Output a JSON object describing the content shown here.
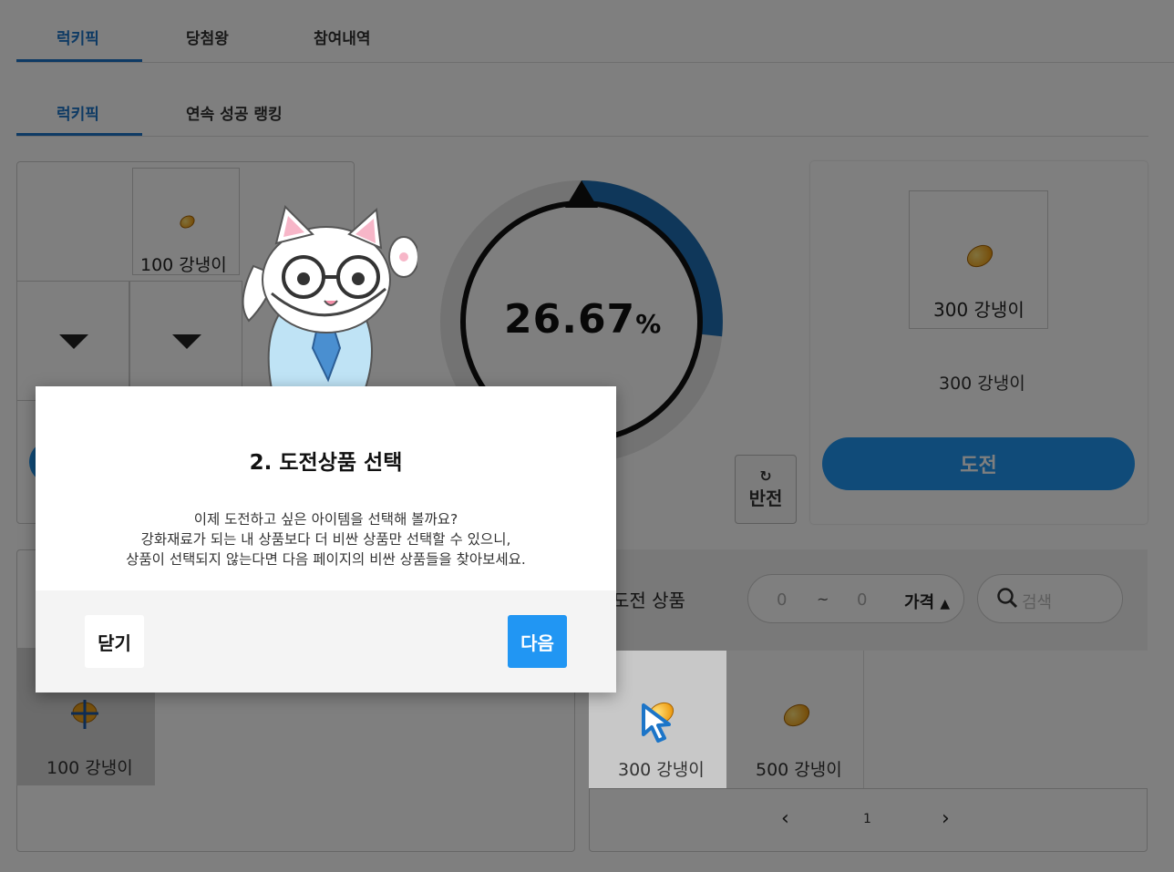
{
  "tabs_main": [
    "럭키픽",
    "당첨왕",
    "참여내역"
  ],
  "tabs_sub": [
    "럭키픽",
    "연속 성공 랭킹"
  ],
  "my_items": {
    "top_item_label": "100 강냉이",
    "bottom_item_label": "100 강냉이"
  },
  "gauge": {
    "percent_value": "26.67",
    "percent_unit": "%",
    "fill_fraction": 0.2667
  },
  "flip_button": {
    "label": "반전"
  },
  "selected_prize": {
    "card_label": "300 강냉이",
    "caption": "300 강냉이",
    "challenge_button": "도전"
  },
  "challenge_list": {
    "title": "도전 상품",
    "price_min": "0",
    "price_sep": "~",
    "price_max": "0",
    "price_sort_label": "가격",
    "search_placeholder": "검색",
    "items": [
      "300 강냉이",
      "500 강냉이"
    ],
    "page_number": "1"
  },
  "dialog": {
    "title": "2. 도전상품 선택",
    "line1": "이제 도전하고 싶은 아이템을 선택해 볼까요?",
    "line2": "강화재료가 되는 내 상품보다 더 비싼 상품만 선택할 수 있으니,",
    "line3": "상품이 선택되지 않는다면 다음 페이지의 비싼 상품들을 찾아보세요.",
    "close_button": "닫기",
    "next_button": "다음"
  },
  "colors": {
    "accent": "#1c75c8",
    "primary_button": "#2196f3",
    "gauge_fill": "#1f6fb5"
  }
}
